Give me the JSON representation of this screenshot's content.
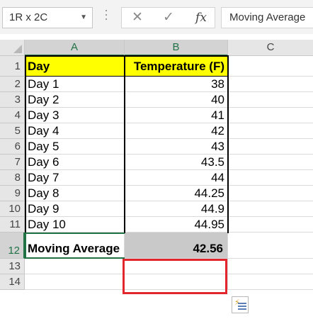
{
  "name_box": {
    "value": "1R x 2C"
  },
  "formula_bar": {
    "cancel_icon": "✕",
    "enter_icon": "✓",
    "fx_label": "fx",
    "content": "Moving Average"
  },
  "columns": [
    "A",
    "B",
    "C"
  ],
  "rows": [
    "1",
    "2",
    "3",
    "4",
    "5",
    "6",
    "7",
    "8",
    "9",
    "10",
    "11",
    "12",
    "13",
    "14"
  ],
  "table": {
    "header": {
      "a": "Day",
      "b": "Temperature (F)"
    },
    "data": [
      {
        "a": "Day 1",
        "b": "38"
      },
      {
        "a": "Day 2",
        "b": "40"
      },
      {
        "a": "Day 3",
        "b": "41"
      },
      {
        "a": "Day 4",
        "b": "42"
      },
      {
        "a": "Day 5",
        "b": "43"
      },
      {
        "a": "Day 6",
        "b": "43.5"
      },
      {
        "a": "Day 7",
        "b": "44"
      },
      {
        "a": "Day 8",
        "b": "44.25"
      },
      {
        "a": "Day 9",
        "b": "44.9"
      },
      {
        "a": "Day 10",
        "b": "44.95"
      }
    ],
    "summary": {
      "a": "Moving Average",
      "b": "42.56"
    }
  },
  "colors": {
    "header_fill": "#ffff00",
    "highlight": "#e3252e",
    "selection": "#217346"
  },
  "icons": {
    "quick_analysis": "quick-analysis-icon"
  }
}
